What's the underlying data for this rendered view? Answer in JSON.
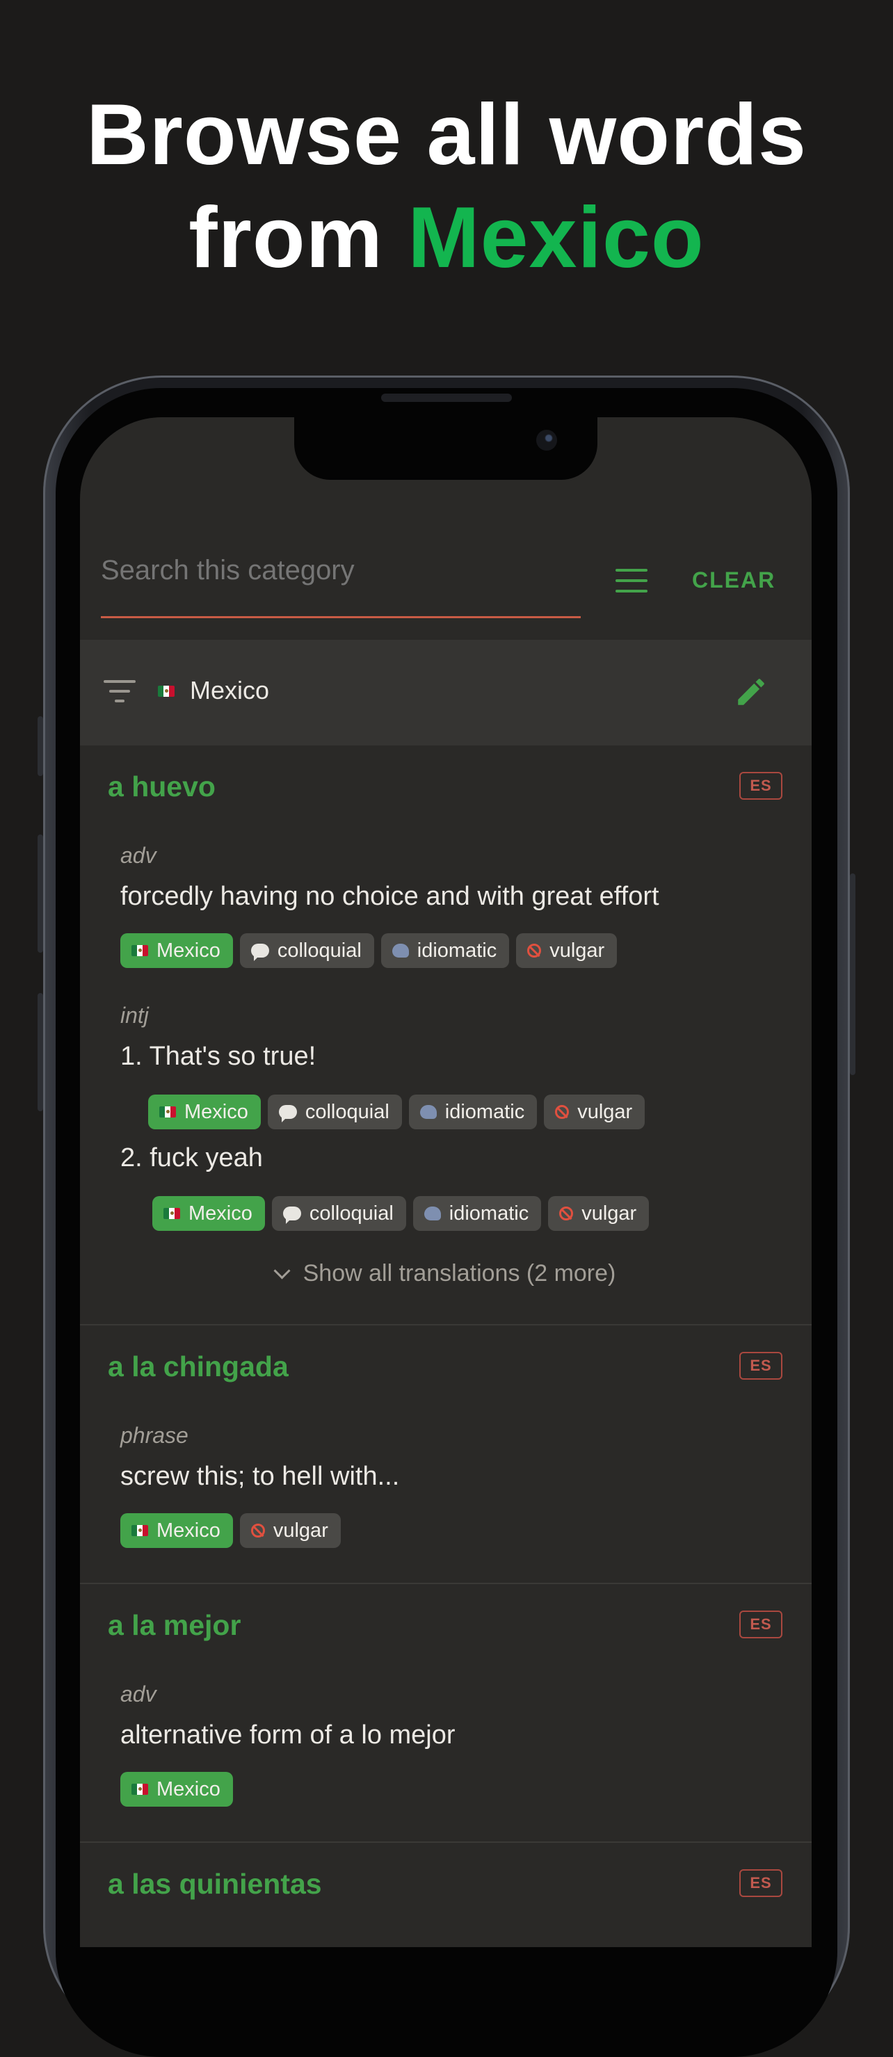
{
  "headline": {
    "line1": "Browse all words",
    "line2_prefix": "from ",
    "line2_accent": "Mexico",
    "accent_color": "#13b54f"
  },
  "search": {
    "placeholder": "Search this category",
    "value": "",
    "menu_icon": "menu-icon",
    "clear_label": "CLEAR"
  },
  "filter": {
    "icon": "filter-icon",
    "flag": "mexico-flag-icon",
    "label": "Mexico",
    "edit_icon": "pencil-icon"
  },
  "colors": {
    "accent_green": "#43a34a",
    "badge_red": "#c25a4f",
    "underline": "#c85b45"
  },
  "entries": [
    {
      "word": "a huevo",
      "lang": "ES",
      "senses": [
        {
          "pos": "adv",
          "definitions": [
            {
              "text": "forcedly having no choice and with great effort",
              "tags": [
                "Mexico",
                "colloquial",
                "idiomatic",
                "vulgar"
              ]
            }
          ]
        },
        {
          "pos": "intj",
          "definitions": [
            {
              "text": "1. That's so true!",
              "tags": [
                "Mexico",
                "colloquial",
                "idiomatic",
                "vulgar"
              ]
            },
            {
              "text": "2. fuck yeah",
              "tags": [
                "Mexico",
                "colloquial",
                "idiomatic",
                "vulgar"
              ]
            }
          ]
        }
      ],
      "show_more": "Show all translations (2 more)"
    },
    {
      "word": "a la chingada",
      "lang": "ES",
      "senses": [
        {
          "pos": "phrase",
          "definitions": [
            {
              "text": "screw this; to hell with...",
              "tags": [
                "Mexico",
                "vulgar"
              ]
            }
          ]
        }
      ]
    },
    {
      "word": "a la mejor",
      "lang": "ES",
      "senses": [
        {
          "pos": "adv",
          "definitions": [
            {
              "text": "alternative form of a lo mejor",
              "tags": [
                "Mexico"
              ]
            }
          ]
        }
      ]
    },
    {
      "word": "a las quinientas",
      "lang": "ES",
      "senses": []
    }
  ]
}
